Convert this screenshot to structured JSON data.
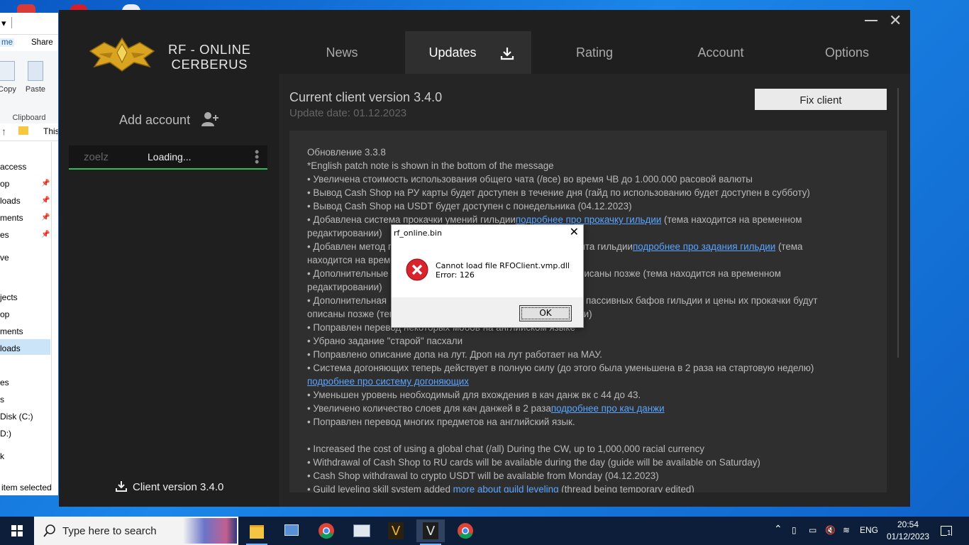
{
  "explorer": {
    "tabs": [
      "me",
      "Share"
    ],
    "ribbon": [
      "Copy",
      "Paste"
    ],
    "ribbon_group": "Clipboard",
    "address": "This",
    "nav_items": [
      "access",
      "op",
      "loads",
      "ments",
      "es",
      "ve",
      "jects",
      "op",
      "ments",
      "loads",
      "es",
      "s",
      "Disk (C:)",
      "D:)",
      "k"
    ],
    "status": "item selected"
  },
  "launcher": {
    "logo_text_line1": "RF - ONLINE",
    "logo_text_line2": "CERBERUS",
    "tabs": [
      {
        "label": "News"
      },
      {
        "label": "Updates"
      },
      {
        "label": "Rating"
      },
      {
        "label": "Account"
      },
      {
        "label": "Options"
      }
    ],
    "active_tab": "Updates",
    "add_account": "Add account",
    "account": {
      "name": "zoelz",
      "status": "Loading..."
    },
    "client_version": "Client version 3.4.0",
    "current_version": "Current client version 3.4.0",
    "update_date": "Update date: 01.12.2023",
    "fix_client": "Fix client",
    "notes": [
      [
        {
          "t": "Обновление 3.3.8"
        }
      ],
      [
        {
          "t": "*English patch note is shown in the bottom of the message"
        }
      ],
      [
        {
          "t": "• Увеличена стоимость использования общего чата (/все) во время ЧВ до 1.000.000 расовой валюты"
        }
      ],
      [
        {
          "t": "• Вывод Cash Shop на РУ карты будет доступен в течение дня (гайд по использованию будет доступен в субботу)"
        }
      ],
      [
        {
          "t": "• Вывод Cash Shop на USDT будет доступен с понедельника (04.12.2023)"
        }
      ],
      [
        {
          "t": "• Добавлена система прокачки умений гильдии"
        },
        {
          "t": "подробнее про прокачку гильдии",
          "link": true
        },
        {
          "t": " (тема находится на временном"
        }
      ],
      [
        {
          "t": "редактировании)"
        }
      ],
      [
        {
          "t": "• Добавлен метод получения опыта гильдии                         опыта гильдии"
        },
        {
          "t": "подробнее про задания гильдии",
          "link": true
        },
        {
          "t": " (тема"
        }
      ],
      [
        {
          "t": "находится на временном редактировании)"
        }
      ],
      [
        {
          "t": "• Дополнительные                                                            будут описаны позже (тема находится на временном"
        }
      ],
      [
        {
          "t": "редактировании)"
        }
      ],
      [
        {
          "t": "• Дополнительная                                                           начениях пассивных бафов гильдии и цены их прокачки будут"
        }
      ],
      [
        {
          "t": "описаны позже (тема находится на временном редактировании)"
        }
      ],
      [
        {
          "t": "• Поправлен перевод некоторых мобов на английском языке"
        }
      ],
      [
        {
          "t": "• Убрано задание \"старой\" пасхали"
        }
      ],
      [
        {
          "t": "• Поправлено описание допа на лут. Дроп на лут работает на МАУ."
        }
      ],
      [
        {
          "t": "• Система догоняющих теперь действует в полную силу (до этого была уменьшена в 2 раза на стартовую неделю)"
        }
      ],
      [
        {
          "t": "подробнее про систему догоняющих",
          "link": true
        }
      ],
      [
        {
          "t": "• Уменьшен уровень необходимый для вхождения в кач данж вк с 44 до 43."
        }
      ],
      [
        {
          "t": "• Увеличено количество слоев для кач данжей в 2 раза"
        },
        {
          "t": "подробнее про кач данжи",
          "link": true
        }
      ],
      [
        {
          "t": "• Поправлен перевод многих предметов на английский язык."
        }
      ],
      [
        {
          "t": " "
        }
      ],
      [
        {
          "t": "• Increased the cost of using a global chat (/all) During the CW, up to 1,000,000 racial currency"
        }
      ],
      [
        {
          "t": "• Withdrawal of Cash Shop to RU cards will be available during the day (guide will be available on Saturday)"
        }
      ],
      [
        {
          "t": "• Cash Shop withdrawal to crypto USDT will be available from Monday (04.12.2023)"
        }
      ],
      [
        {
          "t": "• Guild leveling skill system added "
        },
        {
          "t": "more about guild leveling",
          "link": true
        },
        {
          "t": " (thread being temporary edited)"
        }
      ]
    ]
  },
  "dialog": {
    "title": "rf_online.bin",
    "message_line1": "Cannot load file RFOClient.vmp.dll",
    "message_line2": "Error: 126",
    "ok": "OK"
  },
  "taskbar": {
    "search_placeholder": "Type here to search",
    "language": "ENG",
    "time": "20:54",
    "date": "01/12/2023",
    "notifications": "1"
  },
  "colors": {
    "accent": "#f0a020",
    "link": "#5aa4ff",
    "account_underline": "#2bbf5a",
    "error_red": "#d8242a"
  }
}
